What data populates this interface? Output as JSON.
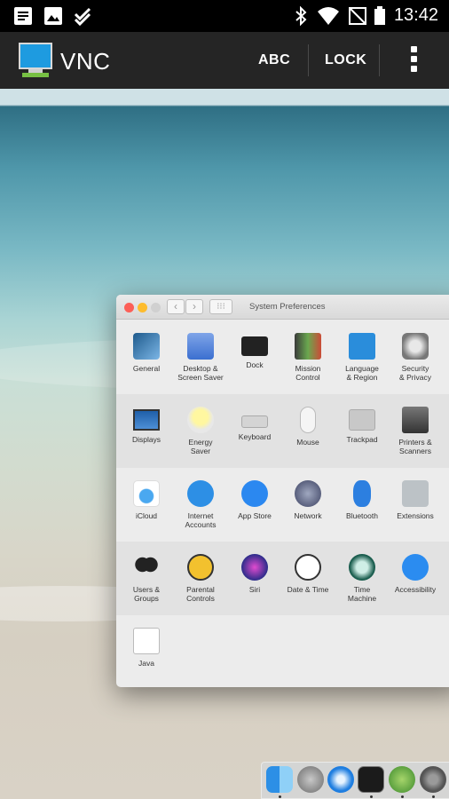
{
  "status_bar": {
    "time": "13:42",
    "left_icons": [
      "notes-icon",
      "image-icon",
      "checkmark-icon"
    ],
    "right_icons": [
      "bluetooth-icon",
      "wifi-icon",
      "no-signal-icon",
      "battery-icon"
    ]
  },
  "app_bar": {
    "title": "VNC",
    "action_keyboard": "ABC",
    "action_lock": "LOCK",
    "icon": "monitor-icon"
  },
  "window": {
    "title": "System Preferences",
    "rows": [
      [
        {
          "label": "General",
          "icon": "general-icon"
        },
        {
          "label": "Desktop &\nScreen Saver",
          "icon": "desktop-icon"
        },
        {
          "label": "Dock",
          "icon": "dock-icon"
        },
        {
          "label": "Mission\nControl",
          "icon": "mission-control-icon"
        },
        {
          "label": "Language\n& Region",
          "icon": "language-icon"
        },
        {
          "label": "Security\n& Privacy",
          "icon": "security-icon"
        }
      ],
      [
        {
          "label": "Displays",
          "icon": "displays-icon"
        },
        {
          "label": "Energy\nSaver",
          "icon": "energy-icon"
        },
        {
          "label": "Keyboard",
          "icon": "keyboard-icon"
        },
        {
          "label": "Mouse",
          "icon": "mouse-icon"
        },
        {
          "label": "Trackpad",
          "icon": "trackpad-icon"
        },
        {
          "label": "Printers &\nScanners",
          "icon": "printer-icon"
        }
      ],
      [
        {
          "label": "iCloud",
          "icon": "icloud-icon"
        },
        {
          "label": "Internet\nAccounts",
          "icon": "internet-accounts-icon"
        },
        {
          "label": "App Store",
          "icon": "app-store-icon"
        },
        {
          "label": "Network",
          "icon": "network-icon"
        },
        {
          "label": "Bluetooth",
          "icon": "bluetooth-pref-icon"
        },
        {
          "label": "Extensions",
          "icon": "extensions-icon"
        }
      ],
      [
        {
          "label": "Users &\nGroups",
          "icon": "users-icon"
        },
        {
          "label": "Parental\nControls",
          "icon": "parental-icon"
        },
        {
          "label": "Siri",
          "icon": "siri-icon"
        },
        {
          "label": "Date & Time",
          "icon": "clock-icon"
        },
        {
          "label": "Time\nMachine",
          "icon": "time-machine-icon"
        },
        {
          "label": "Accessibility",
          "icon": "accessibility-icon"
        }
      ],
      [
        {
          "label": "Java",
          "icon": "java-icon"
        }
      ]
    ]
  },
  "dock": {
    "apps": [
      "finder-icon",
      "launchpad-icon",
      "safari-icon",
      "terminal-icon",
      "android-studio-icon",
      "system-preferences-icon"
    ]
  }
}
